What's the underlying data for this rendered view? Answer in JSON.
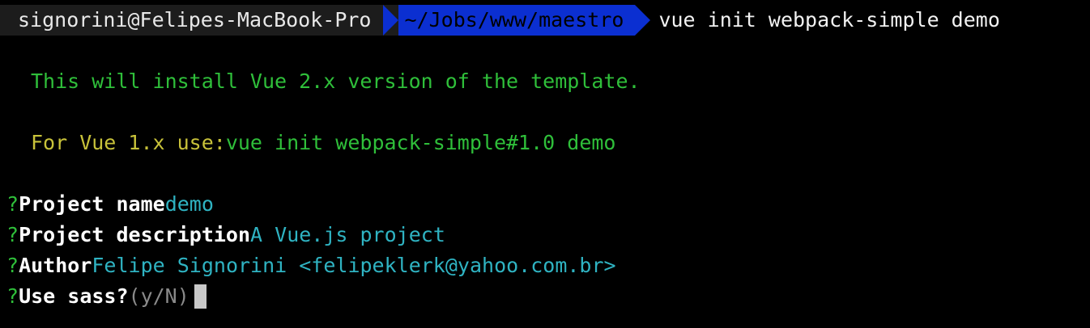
{
  "prompt": {
    "user_host": "signorini@Felipes-MacBook-Pro",
    "path": "~/Jobs/www/maestro",
    "command": "vue init webpack-simple demo"
  },
  "output": {
    "info_line": "This will install Vue 2.x version of the template.",
    "legacy_label": "For Vue 1.x use:",
    "legacy_command": "vue init webpack-simple#1.0 demo"
  },
  "questions": [
    {
      "mark": "?",
      "label": "Project name",
      "answer": "demo"
    },
    {
      "mark": "?",
      "label": "Project description",
      "answer": "A Vue.js project"
    },
    {
      "mark": "?",
      "label": "Author",
      "answer": "Felipe Signorini <felipeklerk@yahoo.com.br>"
    },
    {
      "mark": "?",
      "label": "Use sass?",
      "hint": "(y/N)"
    }
  ],
  "colors": {
    "background": "#000000",
    "path_segment": "#0b2fd1",
    "green": "#2fbf3a",
    "yellow": "#c8c23a",
    "cyan": "#2fb3c2"
  }
}
